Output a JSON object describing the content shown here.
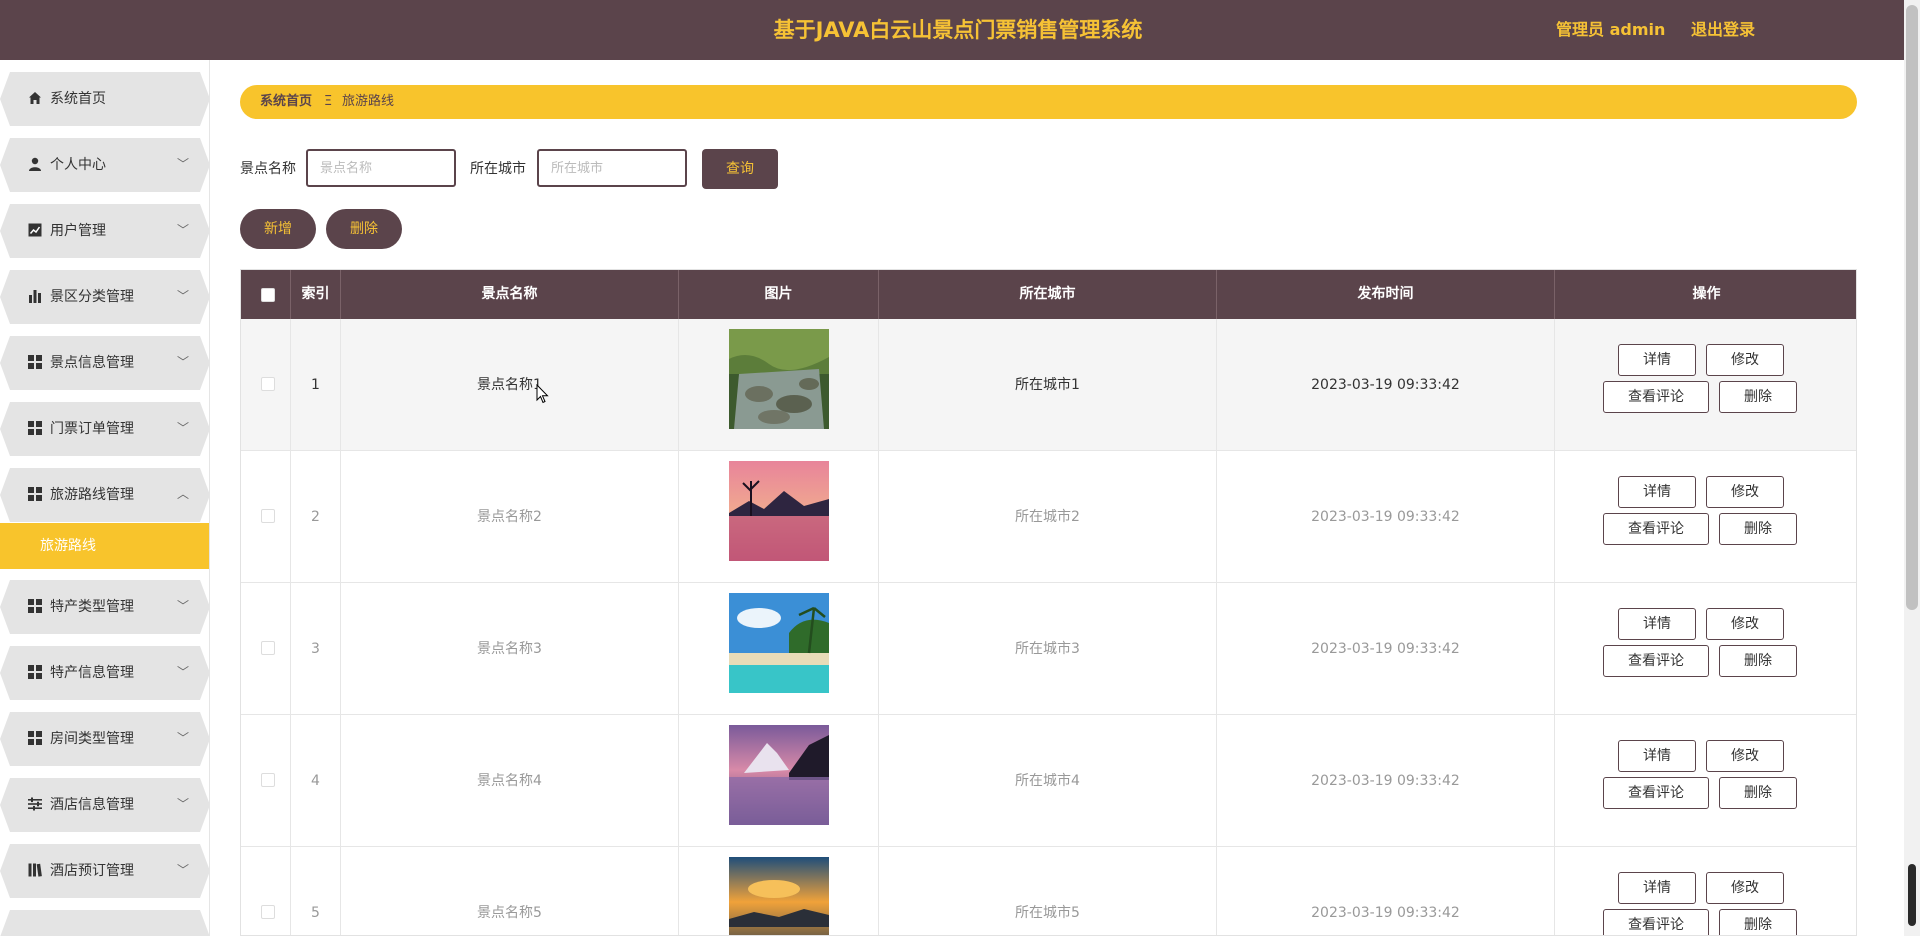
{
  "app": {
    "title": "基于JAVA白云山景点门票销售管理系统",
    "user_label": "管理员 admin",
    "logout_label": "退出登录"
  },
  "sidebar": {
    "items": [
      {
        "label": "系统首页",
        "icon": "home-icon",
        "expandable": false
      },
      {
        "label": "个人中心",
        "icon": "user-icon",
        "expandable": true
      },
      {
        "label": "用户管理",
        "icon": "trend-chart-icon",
        "expandable": true
      },
      {
        "label": "景区分类管理",
        "icon": "bar-chart-icon",
        "expandable": true
      },
      {
        "label": "景点信息管理",
        "icon": "grid-icon",
        "expandable": true
      },
      {
        "label": "门票订单管理",
        "icon": "grid-icon",
        "expandable": true
      },
      {
        "label": "旅游路线管理",
        "icon": "grid-icon",
        "expandable": true,
        "expanded": true
      },
      {
        "label": "特产类型管理",
        "icon": "grid-icon",
        "expandable": true
      },
      {
        "label": "特产信息管理",
        "icon": "grid-icon",
        "expandable": true
      },
      {
        "label": "房间类型管理",
        "icon": "grid-icon",
        "expandable": true
      },
      {
        "label": "酒店信息管理",
        "icon": "sliders-icon",
        "expandable": true
      },
      {
        "label": "酒店预订管理",
        "icon": "book-icon",
        "expandable": true
      }
    ],
    "active_submenu": "旅游路线"
  },
  "breadcrumb": {
    "home": "系统首页",
    "separator": "Ξ",
    "current": "旅游路线"
  },
  "search": {
    "name_label": "景点名称",
    "name_placeholder": "景点名称",
    "name_value": "",
    "city_label": "所在城市",
    "city_placeholder": "所在城市",
    "city_value": "",
    "query_button": "查询"
  },
  "actions": {
    "add_button": "新增",
    "delete_button": "删除"
  },
  "table": {
    "columns": [
      "索引",
      "景点名称",
      "图片",
      "所在城市",
      "发布时间",
      "操作"
    ],
    "rows": [
      {
        "index": "1",
        "name": "景点名称1",
        "city": "所在城市1",
        "time": "2023-03-19 09:33:42",
        "image": "stream-rocks"
      },
      {
        "index": "2",
        "name": "景点名称2",
        "city": "所在城市2",
        "time": "2023-03-19 09:33:42",
        "image": "sunset-lake"
      },
      {
        "index": "3",
        "name": "景点名称3",
        "city": "所在城市3",
        "time": "2023-03-19 09:33:42",
        "image": "tropical-beach"
      },
      {
        "index": "4",
        "name": "景点名称4",
        "city": "所在城市4",
        "time": "2023-03-19 09:33:42",
        "image": "mountain-lake"
      },
      {
        "index": "5",
        "name": "景点名称5",
        "city": "所在城市5",
        "time": "2023-03-19 09:33:42",
        "image": "dramatic-sunset"
      }
    ],
    "row_actions": {
      "detail": "详情",
      "edit": "修改",
      "comments": "查看评论",
      "delete": "删除"
    }
  },
  "colors": {
    "primary": "#5b444b",
    "accent": "#f8c42c",
    "header_text": "#f6c235"
  }
}
